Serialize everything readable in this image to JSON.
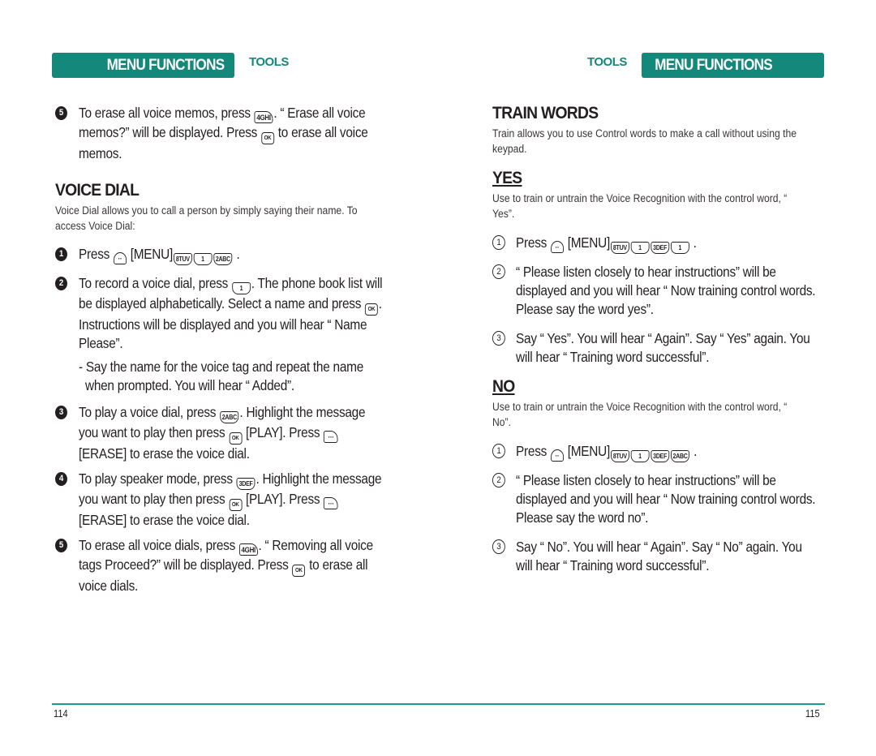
{
  "header": {
    "left": {
      "section_label": "MENU FUNCTIONS",
      "subsection_label": "TOOLS"
    },
    "right": {
      "subsection_label": "TOOLS",
      "section_label": "MENU FUNCTIONS"
    },
    "accent_color": "#14887a"
  },
  "left_page": {
    "intro_step": {
      "number": "5",
      "parts": [
        "To erase all voice memos, press",
        "4GHI",
        ". “ Erase all voice memos?” will be displayed. Press",
        "OK",
        "to erase all voice memos."
      ]
    },
    "voice_dial": {
      "title": "VOICE DIAL",
      "description": "Voice Dial allows you to call a person by simply saying their name. To access Voice Dial:",
      "steps": [
        {
          "number": "1",
          "parts": [
            "Press",
            "··",
            "[MENU]",
            "8TUV",
            "1",
            "2ABC",
            "."
          ]
        },
        {
          "number": "2",
          "parts": [
            "To record a voice dial, press",
            "1",
            ". The phone book list will be displayed alphabetically. Select a name and press",
            "OK",
            ". Instructions will be displayed and you will hear “ Name Please”."
          ],
          "note": "- Say the name for the voice tag and repeat the name when prompted. You will hear “ Added”."
        },
        {
          "number": "3",
          "parts": [
            "To play a voice dial, press",
            "2ABC",
            ". Highlight the message you want to play then press",
            "OK",
            "[PLAY]. Press",
            "···",
            "[ERASE] to erase the voice dial."
          ]
        },
        {
          "number": "4",
          "parts": [
            "To play speaker mode, press",
            "3DEF",
            ". Highlight the message you want to play then press",
            "OK",
            "[PLAY]. Press",
            "···",
            "[ERASE] to erase the voice dial."
          ]
        },
        {
          "number": "5",
          "parts": [
            "To erase all voice dials, press",
            "4GHI",
            ". “ Removing all voice tags Proceed?” will be displayed. Press",
            "OK",
            "to erase all voice dials."
          ]
        }
      ]
    },
    "page_number": "114"
  },
  "right_page": {
    "train_words": {
      "title": "TRAIN WORDS",
      "description": "Train allows you to use Control words to make a call without using the keypad."
    },
    "yes": {
      "title": "YES",
      "description": "Use to train or untrain the Voice Recognition with the control word, “ Yes”.",
      "steps": [
        {
          "number": "1",
          "parts": [
            "Press",
            "··",
            "[MENU]",
            "8TUV",
            "1",
            "3DEF",
            "1",
            "."
          ]
        },
        {
          "number": "2",
          "text": "“ Please listen closely to hear instructions” will be displayed and you will hear “ Now training control words. Please say the word yes”."
        },
        {
          "number": "3",
          "text": "Say “ Yes”. You will hear “ Again”. Say “ Yes” again. You will hear “ Training word successful”."
        }
      ]
    },
    "no": {
      "title": "NO",
      "description": "Use to train or untrain the Voice Recognition with the control word, “ No”.",
      "steps": [
        {
          "number": "1",
          "parts": [
            "Press",
            "··",
            "[MENU]",
            "8TUV",
            "1",
            "3DEF",
            "2ABC",
            "."
          ]
        },
        {
          "number": "2",
          "text": "“ Please listen closely to hear instructions” will be displayed and you will hear “ Now training control words. Please say the word no”."
        },
        {
          "number": "3",
          "text": "Say “ No”. You will hear “ Again”. Say “ No” again. You will hear “ Training word successful”."
        }
      ]
    },
    "page_number": "115"
  }
}
